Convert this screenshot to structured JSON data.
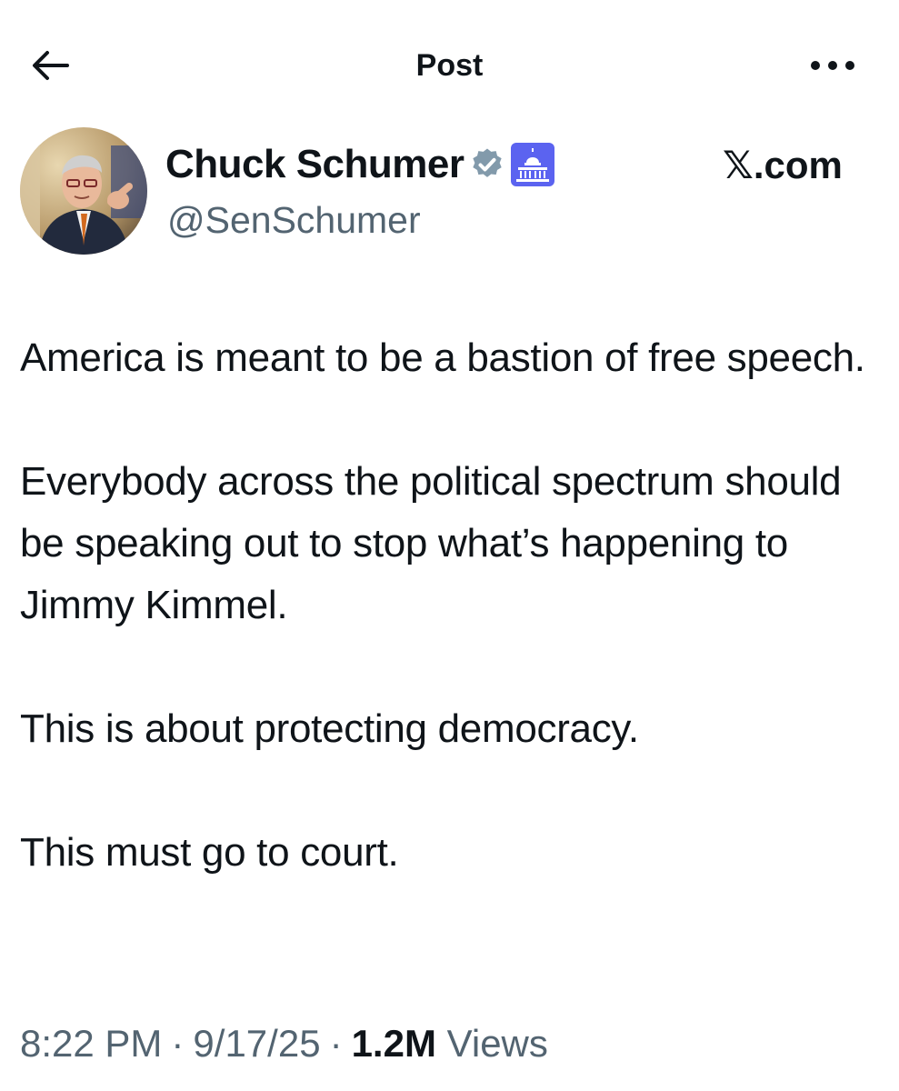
{
  "header": {
    "title": "Post",
    "back_icon": "arrow-left-icon",
    "more_icon": "ellipsis-icon"
  },
  "author": {
    "display_name": "Chuck Schumer",
    "handle": "@SenSchumer",
    "verified_icon": "verified-badge-icon",
    "affiliation_icon": "capitol-building-icon",
    "verified_color": "#829aab",
    "affiliation_color": "#5b63f0"
  },
  "source": {
    "label": "𝕏.com"
  },
  "post": {
    "paragraphs": [
      "America is meant to be a bastion of free speech.",
      "Everybody across the political spectrum should be speaking out to stop what’s happening to Jimmy Kimmel.",
      "This is about protecting democracy.",
      "This must go to court."
    ]
  },
  "meta": {
    "time": "8:22 PM",
    "date": "9/17/25",
    "separator": "·",
    "views_count": "1.2M",
    "views_label": "Views"
  }
}
